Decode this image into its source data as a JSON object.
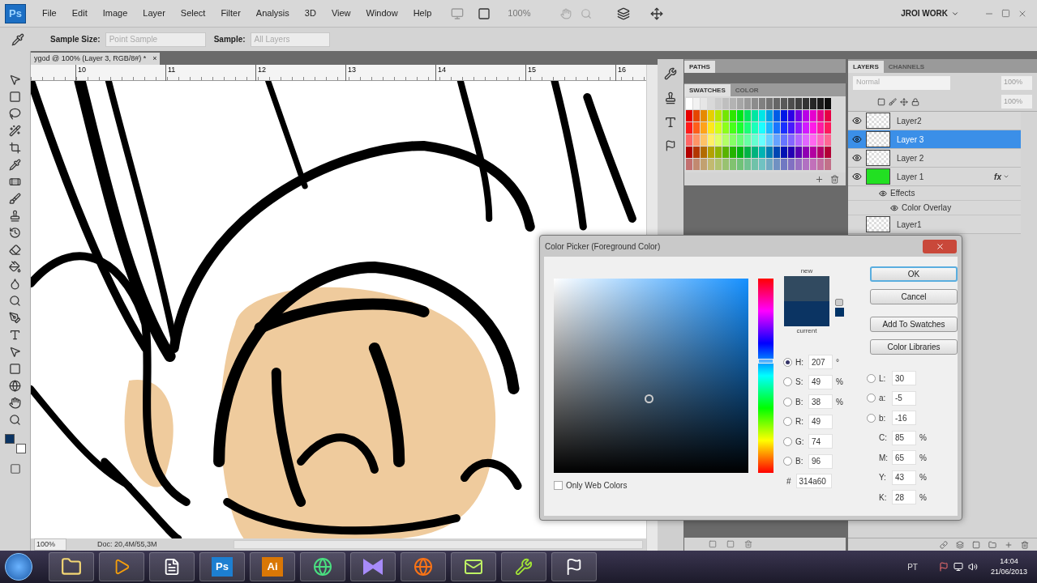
{
  "menu": {
    "logo": "Ps",
    "items": [
      "File",
      "Edit",
      "Image",
      "Layer",
      "Select",
      "Filter",
      "Analysis",
      "3D",
      "View",
      "Window",
      "Help"
    ],
    "zoom": "100%",
    "workspace": "JROI WORK"
  },
  "options": {
    "sample_size_label": "Sample Size:",
    "sample_size": "Point Sample",
    "sample_label": "Sample:",
    "sample": "All Layers"
  },
  "document": {
    "tab_title": "ygod @ 100% (Layer 3, RGB/8#) *",
    "close": "×",
    "ruler": [
      "10",
      "11",
      "12",
      "13",
      "14",
      "15",
      "16"
    ]
  },
  "tools": {
    "swatches": [
      {
        "kind": "foreground",
        "color": "#0b3463"
      },
      {
        "kind": "background",
        "color": "#ffffff"
      }
    ]
  },
  "panels": {
    "paths_tab": "PATHS",
    "swatch_tabs": [
      {
        "label": "SWATCHES",
        "selected": true
      },
      {
        "label": "COLOR",
        "selected": false
      }
    ],
    "layer_tabs": [
      {
        "label": "LAYERS",
        "selected": true
      },
      {
        "label": "CHANNELS",
        "selected": false
      }
    ],
    "blend_mode": "Normal",
    "opacity": "100%",
    "fill": "100%",
    "layers": [
      {
        "name": "Layer2",
        "selected": false,
        "visible": true,
        "kind": "transparent"
      },
      {
        "name": "Layer 3",
        "selected": true,
        "visible": true,
        "kind": "transparent"
      },
      {
        "name": "Layer 2",
        "selected": false,
        "visible": true,
        "kind": "transparent"
      },
      {
        "name": "Layer 1",
        "selected": false,
        "visible": true,
        "kind": "filled",
        "color": "#22e022",
        "fx": "fx",
        "children": [
          {
            "name": "Effects",
            "children": [
              {
                "name": "Color Overlay"
              }
            ]
          }
        ]
      },
      {
        "name": "Layer1",
        "selected": false,
        "visible": false,
        "kind": "transparent"
      }
    ]
  },
  "color_picker": {
    "title": "Color Picker (Foreground Color)",
    "buttons": [
      {
        "label": "OK",
        "default": true
      },
      {
        "label": "Cancel",
        "default": false
      },
      {
        "label": "Add To Swatches",
        "default": false
      },
      {
        "label": "Color Libraries",
        "default": false
      }
    ],
    "swatches": [
      {
        "label": "new",
        "color": "#314a60"
      },
      {
        "label": "current",
        "color": "#0b3463"
      }
    ],
    "left_fields": [
      {
        "label": "H:",
        "value": "207",
        "unit": "°",
        "kind": "radio",
        "selected": true
      },
      {
        "label": "S:",
        "value": "49",
        "unit": "%",
        "kind": "radio",
        "selected": false
      },
      {
        "label": "B:",
        "value": "38",
        "unit": "%",
        "kind": "radio",
        "selected": false
      },
      {
        "label": "R:",
        "value": "49",
        "kind": "radio",
        "selected": false
      },
      {
        "label": "G:",
        "value": "74",
        "kind": "radio",
        "selected": false
      },
      {
        "label": "B:",
        "value": "96",
        "kind": "radio",
        "selected": false
      }
    ],
    "right_fields": [
      {
        "label": "L:",
        "value": "30",
        "kind": "radio",
        "selected": false
      },
      {
        "label": "a:",
        "value": "-5",
        "kind": "radio",
        "selected": false
      },
      {
        "label": "b:",
        "value": "-16",
        "kind": "radio",
        "selected": false
      },
      {
        "label": "C:",
        "value": "85",
        "unit": "%",
        "kind": "plain"
      },
      {
        "label": "M:",
        "value": "65",
        "unit": "%",
        "kind": "plain"
      },
      {
        "label": "Y:",
        "value": "43",
        "unit": "%",
        "kind": "plain"
      },
      {
        "label": "K:",
        "value": "28",
        "unit": "%",
        "kind": "plain"
      }
    ],
    "hex": {
      "label": "#",
      "value": "314a60"
    },
    "web_only": {
      "label": "Only Web Colors",
      "checked": false
    },
    "hue_slider": {
      "level": 0.575
    }
  },
  "status": {
    "zoom": "100%",
    "doc": "Doc: 20,4M/55,3M"
  },
  "taskbar": {
    "apps": [
      {
        "kind": "folder"
      },
      {
        "kind": "media"
      },
      {
        "kind": "file"
      },
      {
        "kind": "text",
        "label": "Ps",
        "color": "#1d7fd1"
      },
      {
        "kind": "text",
        "label": "Ai",
        "color": "#d97706"
      },
      {
        "kind": "globe"
      },
      {
        "kind": "studio"
      },
      {
        "kind": "browser"
      },
      {
        "kind": "mail"
      },
      {
        "kind": "tool"
      },
      {
        "kind": "bird"
      }
    ],
    "language": "PT",
    "time": "14:04",
    "date": "21/06/2013"
  }
}
